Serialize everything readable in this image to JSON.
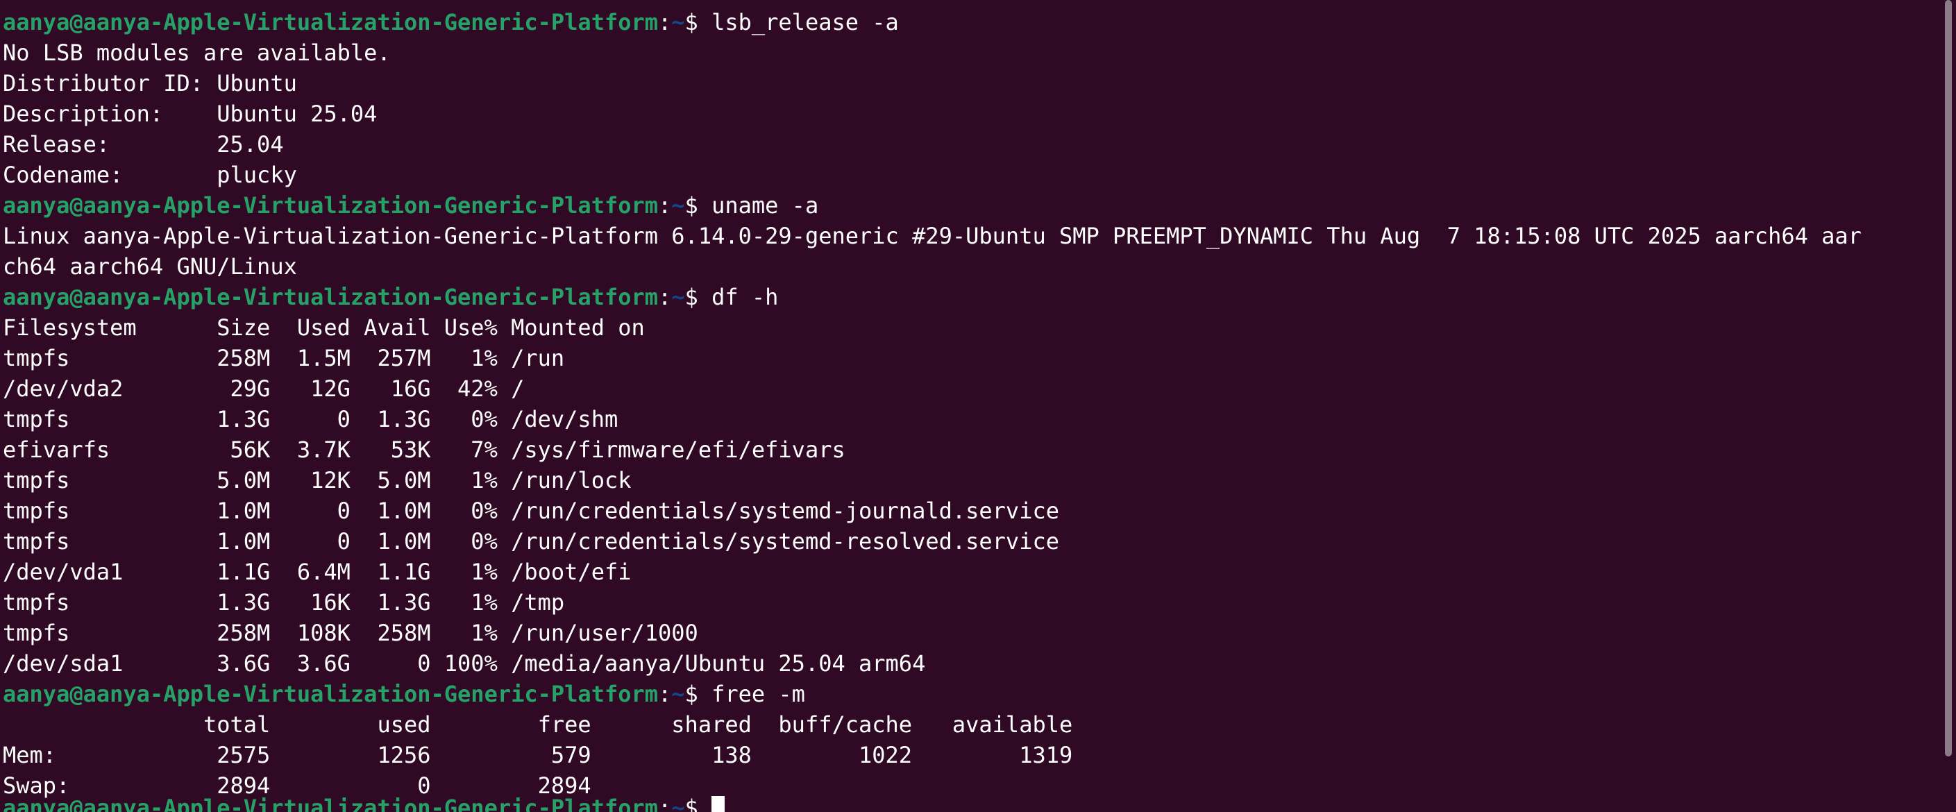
{
  "prompt": {
    "user_host": "aanya@aanya-Apple-Virtualization-Generic-Platform",
    "colon": ":",
    "path": "~",
    "dollar": "$ "
  },
  "colors": {
    "background": "#300a24",
    "prompt_user": "#26a269",
    "prompt_path": "#12488b",
    "text": "#ffffff"
  },
  "commands": [
    "lsb_release -a",
    "uname -a",
    "df -h",
    "free -m"
  ],
  "lsb_output": [
    "No LSB modules are available.",
    "Distributor ID: Ubuntu",
    "Description:    Ubuntu 25.04",
    "Release:        25.04",
    "Codename:       plucky"
  ],
  "uname_output": [
    "Linux aanya-Apple-Virtualization-Generic-Platform 6.14.0-29-generic #29-Ubuntu SMP PREEMPT_DYNAMIC Thu Aug  7 18:15:08 UTC 2025 aarch64 aar",
    "ch64 aarch64 GNU/Linux"
  ],
  "df_output": [
    "Filesystem      Size  Used Avail Use% Mounted on",
    "tmpfs           258M  1.5M  257M   1% /run",
    "/dev/vda2        29G   12G   16G  42% /",
    "tmpfs           1.3G     0  1.3G   0% /dev/shm",
    "efivarfs         56K  3.7K   53K   7% /sys/firmware/efi/efivars",
    "tmpfs           5.0M   12K  5.0M   1% /run/lock",
    "tmpfs           1.0M     0  1.0M   0% /run/credentials/systemd-journald.service",
    "tmpfs           1.0M     0  1.0M   0% /run/credentials/systemd-resolved.service",
    "/dev/vda1       1.1G  6.4M  1.1G   1% /boot/efi",
    "tmpfs           1.3G   16K  1.3G   1% /tmp",
    "tmpfs           258M  108K  258M   1% /run/user/1000",
    "/dev/sda1       3.6G  3.6G     0 100% /media/aanya/Ubuntu 25.04 arm64"
  ],
  "free_output": [
    "               total        used        free      shared  buff/cache   available",
    "Mem:            2575        1256         579         138        1022        1319",
    "Swap:           2894           0        2894"
  ]
}
